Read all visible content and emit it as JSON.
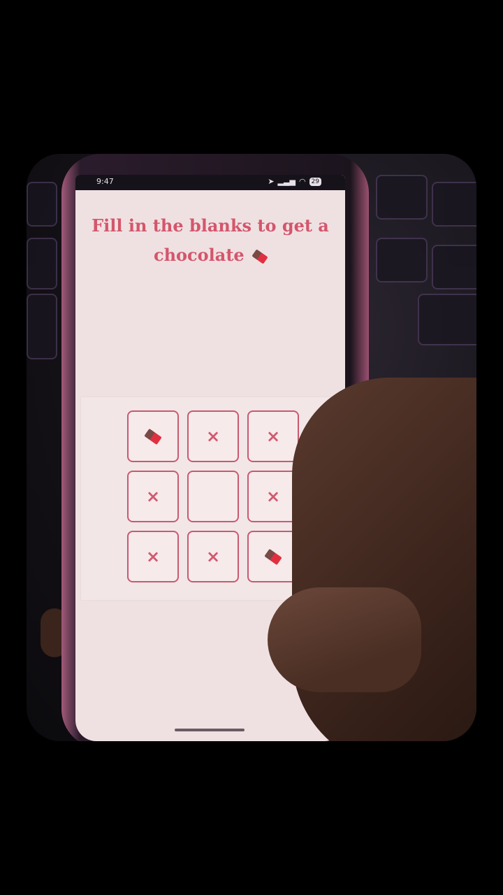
{
  "status_bar": {
    "time": "9:47",
    "battery": "29"
  },
  "headline": {
    "text": "Fill in the blanks to get a chocolate",
    "icon": "chocolate-bar-icon"
  },
  "grid": {
    "cells": [
      {
        "content": "chocolate"
      },
      {
        "content": "x",
        "symbol": "×"
      },
      {
        "content": "x",
        "symbol": "×"
      },
      {
        "content": "x",
        "symbol": "×"
      },
      {
        "content": "empty",
        "symbol": ""
      },
      {
        "content": "x",
        "symbol": "×"
      },
      {
        "content": "x",
        "symbol": "×"
      },
      {
        "content": "x",
        "symbol": "×"
      },
      {
        "content": "chocolate"
      }
    ]
  },
  "colors": {
    "accent": "#d4566c",
    "background": "#efe1e2"
  }
}
